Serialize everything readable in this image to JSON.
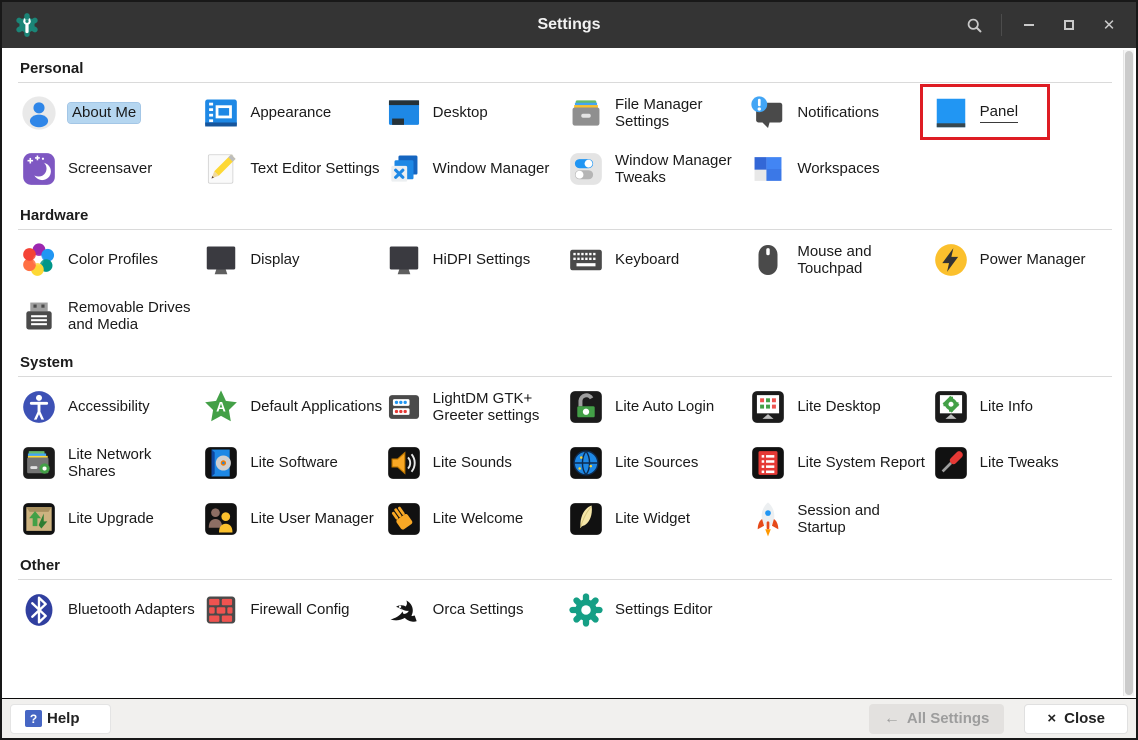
{
  "colors": {
    "titlebar_bg": "#343434",
    "accent_blue": "#2196f3",
    "selection_highlight": "#b5d6f0",
    "annotation_red": "#de1c23",
    "footer_bg": "#f1f0ee",
    "app_icon_teal": "#1b8577",
    "help_icon_blue": "#4666c4"
  },
  "titlebar": {
    "title": "Settings",
    "icons": [
      "app-settings-icon",
      "search-icon",
      "minimize-icon",
      "maximize-icon",
      "close-icon"
    ]
  },
  "sections": [
    {
      "name": "Personal",
      "items": [
        {
          "label": "About Me",
          "icon": "about-me-icon",
          "selected": true
        },
        {
          "label": "Appearance",
          "icon": "appearance-icon"
        },
        {
          "label": "Desktop",
          "icon": "desktop-icon"
        },
        {
          "label": "File Manager Settings",
          "icon": "file-manager-icon"
        },
        {
          "label": "Notifications",
          "icon": "notifications-icon"
        },
        {
          "label": "Panel",
          "icon": "panel-icon",
          "focused": true,
          "annotated": true
        },
        {
          "label": "Screensaver",
          "icon": "screensaver-icon"
        },
        {
          "label": "Text Editor Settings",
          "icon": "text-editor-icon"
        },
        {
          "label": "Window Manager",
          "icon": "window-manager-icon"
        },
        {
          "label": "Window Manager Tweaks",
          "icon": "wm-tweaks-icon"
        },
        {
          "label": "Workspaces",
          "icon": "workspaces-icon"
        }
      ]
    },
    {
      "name": "Hardware",
      "items": [
        {
          "label": "Color Profiles",
          "icon": "color-profiles-icon"
        },
        {
          "label": "Display",
          "icon": "display-icon"
        },
        {
          "label": "HiDPI Settings",
          "icon": "hidpi-icon"
        },
        {
          "label": "Keyboard",
          "icon": "keyboard-icon"
        },
        {
          "label": "Mouse and Touchpad",
          "icon": "mouse-icon"
        },
        {
          "label": "Power Manager",
          "icon": "power-manager-icon"
        },
        {
          "label": "Removable Drives and Media",
          "icon": "removable-drives-icon"
        }
      ]
    },
    {
      "name": "System",
      "items": [
        {
          "label": "Accessibility",
          "icon": "accessibility-icon"
        },
        {
          "label": "Default Applications",
          "icon": "default-apps-icon"
        },
        {
          "label": "LightDM GTK+ Greeter settings",
          "icon": "lightdm-icon"
        },
        {
          "label": "Lite Auto Login",
          "icon": "lite-auto-login-icon"
        },
        {
          "label": "Lite Desktop",
          "icon": "lite-desktop-icon"
        },
        {
          "label": "Lite Info",
          "icon": "lite-info-icon"
        },
        {
          "label": "Lite Network Shares",
          "icon": "lite-network-shares-icon"
        },
        {
          "label": "Lite Software",
          "icon": "lite-software-icon"
        },
        {
          "label": "Lite Sounds",
          "icon": "lite-sounds-icon"
        },
        {
          "label": "Lite Sources",
          "icon": "lite-sources-icon"
        },
        {
          "label": "Lite System Report",
          "icon": "lite-system-report-icon"
        },
        {
          "label": "Lite Tweaks",
          "icon": "lite-tweaks-icon"
        },
        {
          "label": "Lite Upgrade",
          "icon": "lite-upgrade-icon"
        },
        {
          "label": "Lite User Manager",
          "icon": "lite-user-manager-icon"
        },
        {
          "label": "Lite Welcome",
          "icon": "lite-welcome-icon"
        },
        {
          "label": "Lite Widget",
          "icon": "lite-widget-icon"
        },
        {
          "label": "Session and Startup",
          "icon": "session-startup-icon"
        }
      ]
    },
    {
      "name": "Other",
      "items": [
        {
          "label": "Bluetooth Adapters",
          "icon": "bluetooth-icon"
        },
        {
          "label": "Firewall Config",
          "icon": "firewall-icon"
        },
        {
          "label": "Orca Settings",
          "icon": "orca-icon"
        },
        {
          "label": "Settings Editor",
          "icon": "settings-editor-icon"
        }
      ]
    }
  ],
  "footer": {
    "help_label": "Help",
    "help_icon_glyph": "?",
    "all_settings_label": "All Settings",
    "all_settings_arrow": "←",
    "all_settings_disabled": true,
    "close_label": "Close",
    "close_glyph": "×"
  }
}
